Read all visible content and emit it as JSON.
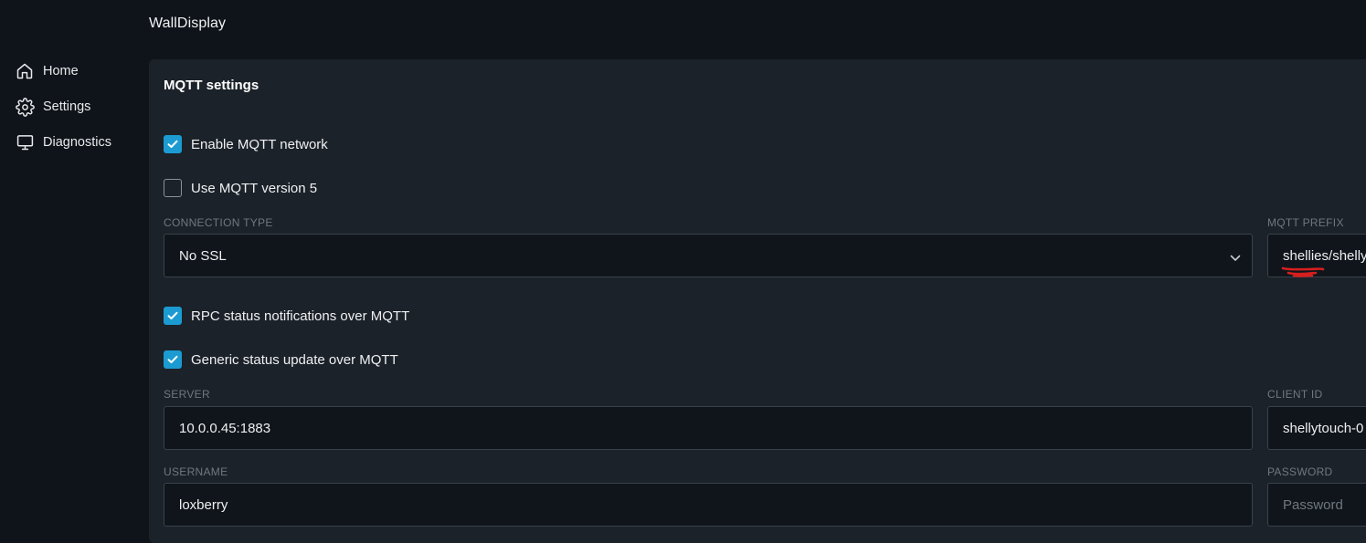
{
  "app": {
    "title": "WallDisplay"
  },
  "sidebar": {
    "items": [
      {
        "label": "Home",
        "icon": "home-icon"
      },
      {
        "label": "Settings",
        "icon": "gear-icon"
      },
      {
        "label": "Diagnostics",
        "icon": "monitor-icon"
      }
    ]
  },
  "mqtt": {
    "section_title": "MQTT settings",
    "enable_network": {
      "label": "Enable MQTT network",
      "checked": true
    },
    "use_v5": {
      "label": "Use MQTT version 5",
      "checked": false
    },
    "connection_type": {
      "label": "CONNECTION TYPE",
      "value": "No SSL"
    },
    "prefix": {
      "label": "MQTT PREFIX",
      "value": "shellies/shelly"
    },
    "rpc_notifications": {
      "label": "RPC status notifications over MQTT",
      "checked": true
    },
    "generic_status": {
      "label": "Generic status update over MQTT",
      "checked": true
    },
    "server": {
      "label": "SERVER",
      "value": "10.0.0.45:1883"
    },
    "client_id": {
      "label": "CLIENT ID",
      "value": "shellytouch-0"
    },
    "username": {
      "label": "USERNAME",
      "value": "loxberry"
    },
    "password": {
      "label": "PASSWORD",
      "placeholder": "Password"
    }
  },
  "colors": {
    "accent": "#1b9bd1",
    "background": "#0f141a",
    "panel": "#1c2229",
    "annotation_mark": "#d61f1f"
  }
}
